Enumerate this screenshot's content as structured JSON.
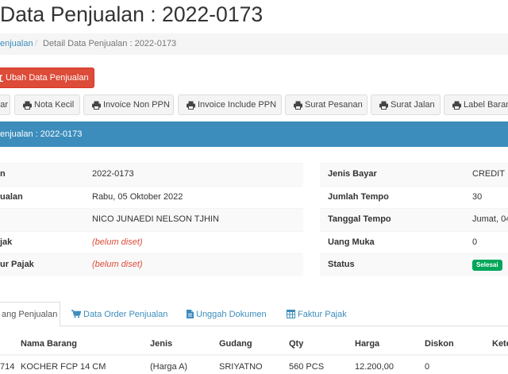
{
  "page": {
    "title": "Data Penjualan : 2022-0173"
  },
  "breadcrumb": {
    "items": [
      "enjualan",
      "Detail Data Penjualan : 2022-0173"
    ],
    "separator": "/"
  },
  "actions": {
    "edit_label": "Ubah Data Penjualan",
    "edit_icon": "edit-icon"
  },
  "print_buttons": [
    {
      "label": "ar"
    },
    {
      "label": "Nota Kecil",
      "icon": "print-icon"
    },
    {
      "label": "Invoice Non PPN",
      "icon": "print-icon"
    },
    {
      "label": "Invoice Include PPN",
      "icon": "print-icon"
    },
    {
      "label": "Surat Pesanan",
      "icon": "print-icon"
    },
    {
      "label": "Surat Jalan",
      "icon": "print-icon"
    },
    {
      "label": "Label Baran",
      "icon": "print-icon"
    }
  ],
  "panel": {
    "title": "enjualan : 2022-0173"
  },
  "details_left": [
    {
      "label": "n",
      "value": "2022-0173"
    },
    {
      "label": "ualan",
      "value": "Rabu, 05 Oktober 2022"
    },
    {
      "value": "NICO JUNAEDI NELSON TJHIN"
    },
    {
      "label": "jak",
      "value": "(belum diset)"
    },
    {
      "label": "ur Pajak",
      "value": "(belum diset)"
    }
  ],
  "details_right": [
    {
      "label": "Jenis Bayar",
      "value": "CREDIT"
    },
    {
      "label": "Jumlah Tempo",
      "value": "30"
    },
    {
      "label": "Tanggal Tempo",
      "value": "Jumat, 04"
    },
    {
      "label": "Uang Muka",
      "value": "0"
    },
    {
      "label": "Status",
      "badge": "Selesai"
    }
  ],
  "tabs": [
    {
      "label": "ang Penjualan",
      "active": true
    },
    {
      "label": "Data Order Penjualan",
      "icon": "cart-icon"
    },
    {
      "label": "Unggah Dokumen",
      "icon": "file-icon"
    },
    {
      "label": "Faktur Pajak",
      "icon": "table-icon"
    }
  ],
  "items_table": {
    "columns": [
      "Nama Barang",
      "Jenis",
      "Gudang",
      "Qty",
      "Harga",
      "Diskon",
      "Kete"
    ],
    "rows": [
      {
        "code": "714",
        "cells": [
          "KOCHER FCP 14 CM",
          "(Harga A)",
          "SRIYATNO",
          "560 PCS",
          "12.200,00",
          "0"
        ]
      }
    ]
  },
  "colors": {
    "accent": "#3c8dbc",
    "danger": "#dd4b39",
    "success": "#00a65a",
    "unset": "#dd4b39"
  }
}
